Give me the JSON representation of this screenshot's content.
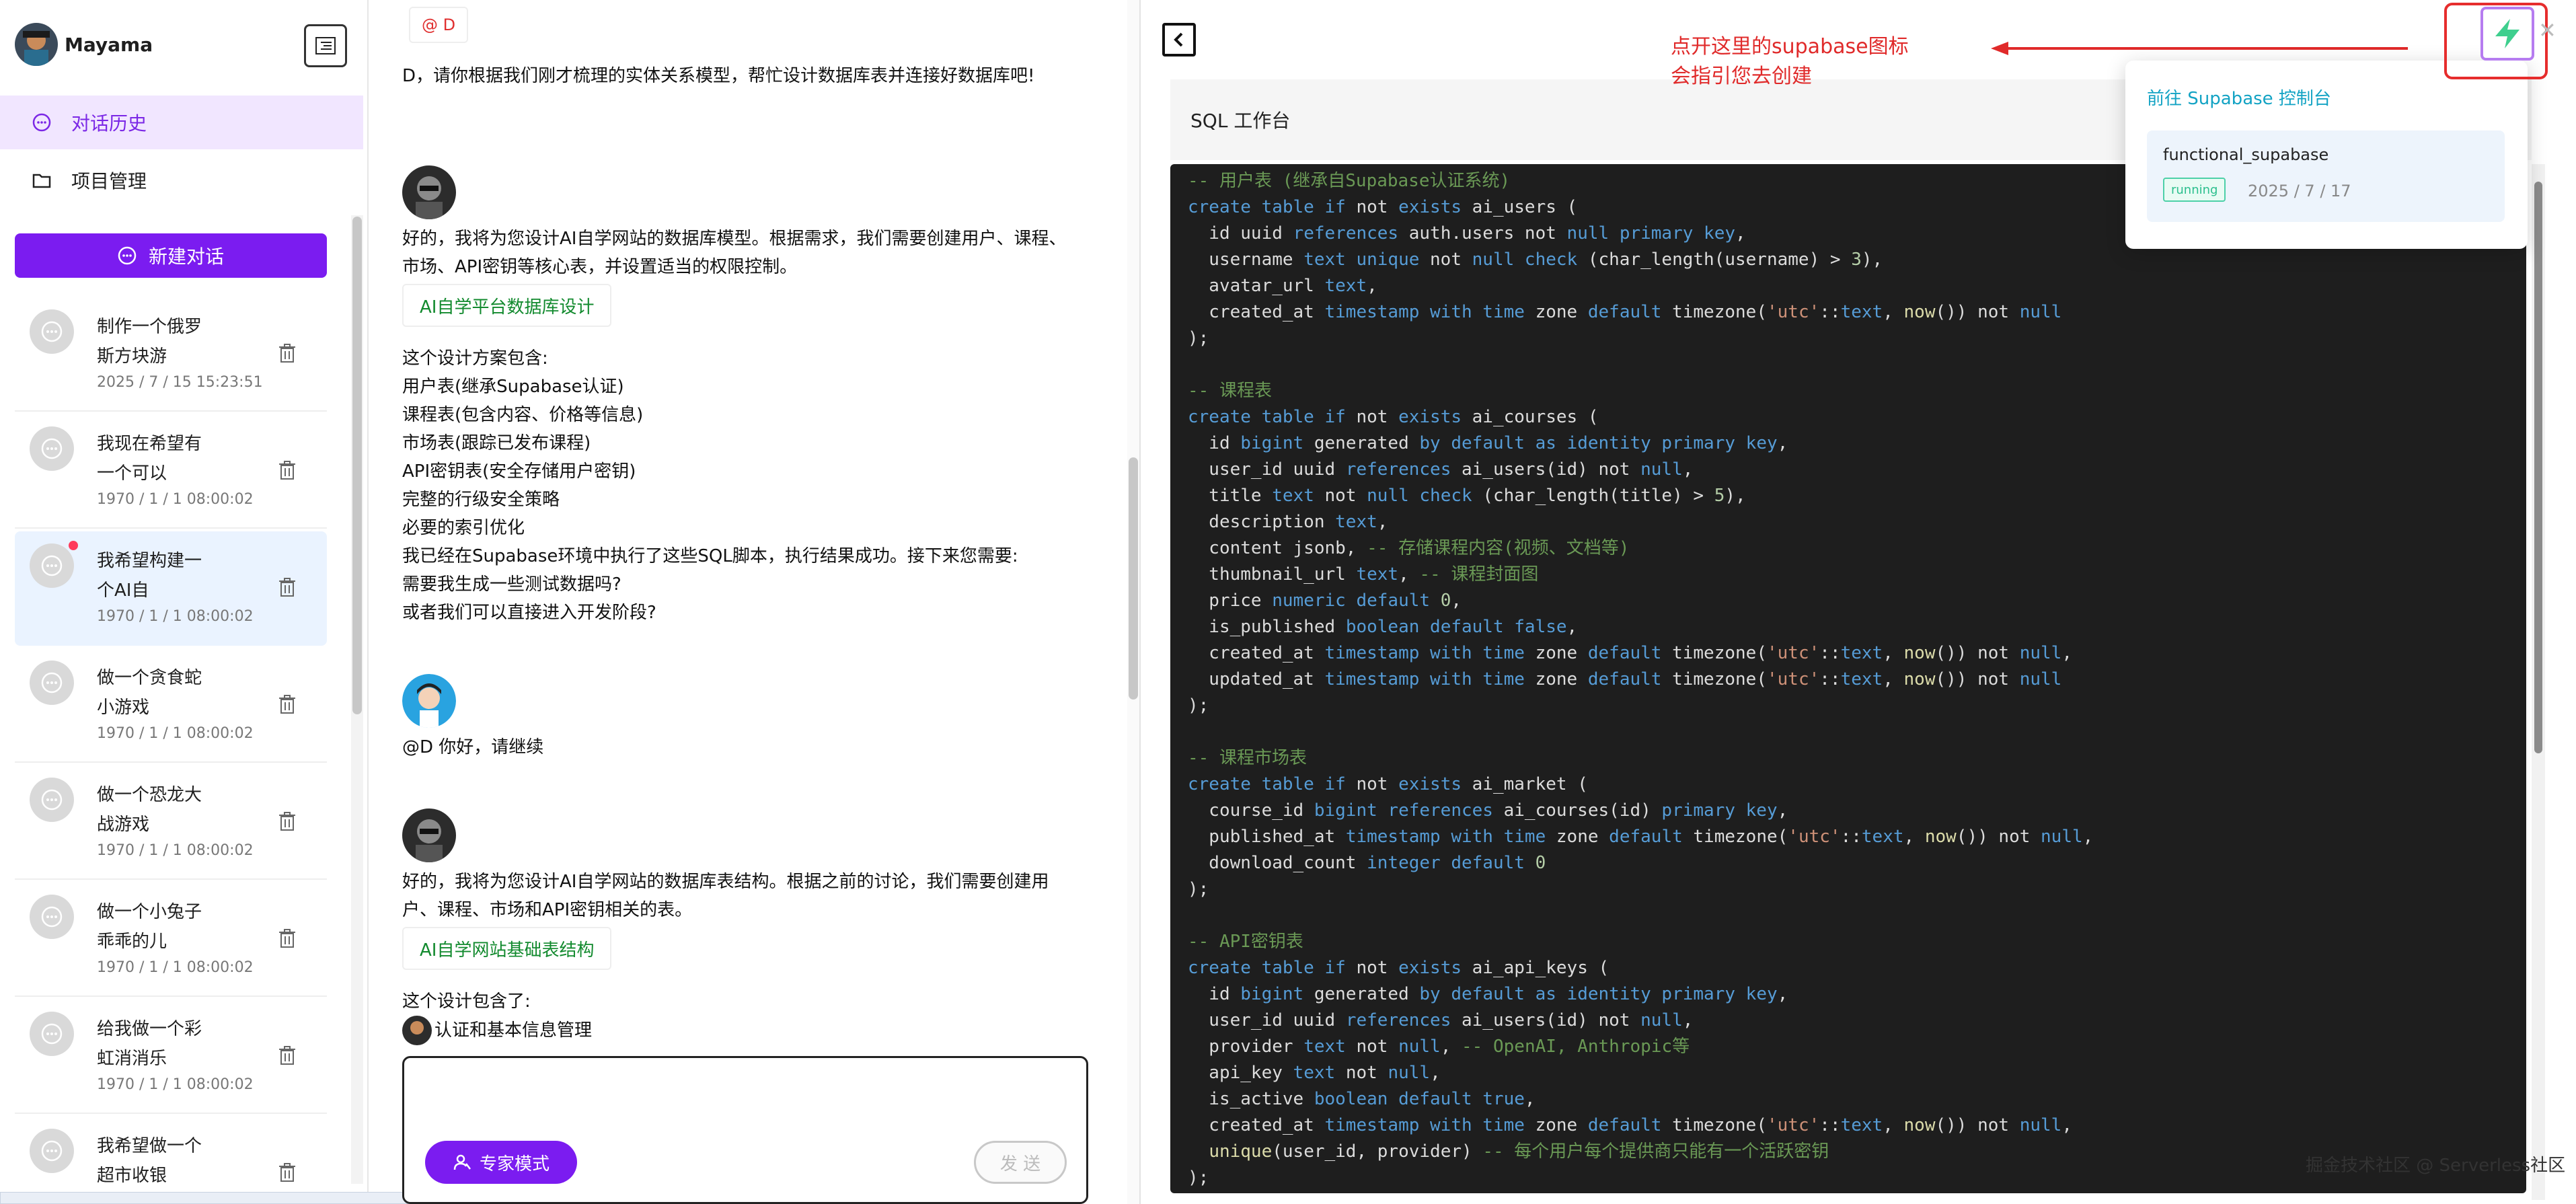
{
  "app": {
    "name": "Mayama"
  },
  "nav": {
    "history": "对话历史",
    "projects": "项目管理"
  },
  "new_chat": "新建对话",
  "conversations": [
    {
      "title": "制作一个俄罗斯方块游",
      "date": "2025 / 7 / 15 15:23:51"
    },
    {
      "title": "我现在希望有一个可以",
      "date": "1970 / 1 / 1 08:00:02"
    },
    {
      "title": "我希望构建一个AI自",
      "date": "1970 / 1 / 1 08:00:02"
    },
    {
      "title": "做一个贪食蛇小游戏",
      "date": "1970 / 1 / 1 08:00:02"
    },
    {
      "title": "做一个恐龙大战游戏",
      "date": "1970 / 1 / 1 08:00:02"
    },
    {
      "title": "做一个小兔子乖乖的儿",
      "date": "1970 / 1 / 1 08:00:02"
    },
    {
      "title": "给我做一个彩虹消消乐",
      "date": "1970 / 1 / 1 08:00:02"
    },
    {
      "title": "我希望做一个超市收银",
      "date": ""
    }
  ],
  "chat": {
    "top_tag": "@ D",
    "prompt": "D，请你根据我们刚才梳理的实体关系模型，帮忙设计数据库表并连接好数据库吧!",
    "reply1_intro": "好的，我将为您设计AI自学网站的数据库模型。根据需求，我们需要创建用户、课程、市场、API密钥等核心表，并设置适当的权限控制。",
    "reply1_link": "AI自学平台数据库设计",
    "reply1_body": [
      "这个设计方案包含:",
      "用户表(继承Supabase认证)",
      "课程表(包含内容、价格等信息)",
      "市场表(跟踪已发布课程)",
      "API密钥表(安全存储用户密钥)",
      "完整的行级安全策略",
      "必要的索引优化",
      "我已经在Supabase环境中执行了这些SQL脚本，执行结果成功。接下来您需要:",
      "需要我生成一些测试数据吗?",
      "或者我们可以直接进入开发阶段?"
    ],
    "user_msg": "@D 你好，请继续",
    "reply2_intro": "好的，我将为您设计AI自学网站的数据库表结构。根据之前的讨论，我们需要创建用户、课程、市场和API密钥相关的表。",
    "reply2_link": "AI自学网站基础表结构",
    "reply2_body": [
      "这个设计包含了:",
      "认证和基本信息管理"
    ],
    "expert_mode": "专家模式",
    "send": "发 送"
  },
  "panel": {
    "title": "SQL 工作台",
    "annotation": [
      "点开这里的supabase图标",
      "会指引您去创建"
    ],
    "popover": {
      "heading": "前往 Supabase 控制台",
      "project": "functional_supabase",
      "status": "running",
      "date": "2025 / 7 / 17"
    },
    "watermark": "掘金技术社区 @ Serverless社区"
  },
  "colors": {
    "brand": "#7b1cf0",
    "annotation": "#e02a2a",
    "supabase": "#3ecf8e"
  },
  "sql_lines": [
    [
      [
        "c",
        "-- 用户表 (继承自Supabase认证系统)"
      ]
    ],
    [
      [
        "k",
        "create table if "
      ],
      [
        "t",
        "not "
      ],
      [
        "k",
        "exists "
      ],
      [
        "t",
        "ai_users ("
      ]
    ],
    [
      [
        "t",
        "  id uuid "
      ],
      [
        "k",
        "references "
      ],
      [
        "t",
        "auth.users not "
      ],
      [
        "k",
        "null primary key"
      ],
      [
        "t",
        ","
      ]
    ],
    [
      [
        "t",
        "  username "
      ],
      [
        "k",
        "text unique "
      ],
      [
        "t",
        "not "
      ],
      [
        "k",
        "null check "
      ],
      [
        "t",
        "(char_length(username) > "
      ],
      [
        "n",
        "3"
      ],
      [
        "t",
        "),"
      ]
    ],
    [
      [
        "t",
        "  avatar_url "
      ],
      [
        "k",
        "text"
      ],
      [
        "t",
        ","
      ]
    ],
    [
      [
        "t",
        "  created_at "
      ],
      [
        "k",
        "timestamp with time "
      ],
      [
        "t",
        "zone "
      ],
      [
        "k",
        "default "
      ],
      [
        "t",
        "timezone("
      ],
      [
        "s",
        "'utc'"
      ],
      [
        "t",
        "::"
      ],
      [
        "k",
        "text"
      ],
      [
        "t",
        ", "
      ],
      [
        "f",
        "now"
      ],
      [
        "t",
        "()) not "
      ],
      [
        "k",
        "null"
      ]
    ],
    [
      [
        "t",
        ");"
      ]
    ],
    [
      [
        "t",
        ""
      ]
    ],
    [
      [
        "c",
        "-- 课程表"
      ]
    ],
    [
      [
        "k",
        "create table if "
      ],
      [
        "t",
        "not "
      ],
      [
        "k",
        "exists "
      ],
      [
        "t",
        "ai_courses ("
      ]
    ],
    [
      [
        "t",
        "  id "
      ],
      [
        "k",
        "bigint "
      ],
      [
        "t",
        "generated "
      ],
      [
        "k",
        "by default as identity primary key"
      ],
      [
        "t",
        ","
      ]
    ],
    [
      [
        "t",
        "  user_id uuid "
      ],
      [
        "k",
        "references "
      ],
      [
        "t",
        "ai_users(id) not "
      ],
      [
        "k",
        "null"
      ],
      [
        "t",
        ","
      ]
    ],
    [
      [
        "t",
        "  title "
      ],
      [
        "k",
        "text "
      ],
      [
        "t",
        "not "
      ],
      [
        "k",
        "null check "
      ],
      [
        "t",
        "(char_length(title) > "
      ],
      [
        "n",
        "5"
      ],
      [
        "t",
        "),"
      ]
    ],
    [
      [
        "t",
        "  description "
      ],
      [
        "k",
        "text"
      ],
      [
        "t",
        ","
      ]
    ],
    [
      [
        "t",
        "  content jsonb, "
      ],
      [
        "c",
        "-- 存储课程内容(视频、文档等)"
      ]
    ],
    [
      [
        "t",
        "  thumbnail_url "
      ],
      [
        "k",
        "text"
      ],
      [
        "t",
        ", "
      ],
      [
        "c",
        "-- 课程封面图"
      ]
    ],
    [
      [
        "t",
        "  price "
      ],
      [
        "k",
        "numeric default "
      ],
      [
        "n",
        "0"
      ],
      [
        "t",
        ","
      ]
    ],
    [
      [
        "t",
        "  is_published "
      ],
      [
        "k",
        "boolean default false"
      ],
      [
        "t",
        ","
      ]
    ],
    [
      [
        "t",
        "  created_at "
      ],
      [
        "k",
        "timestamp with time "
      ],
      [
        "t",
        "zone "
      ],
      [
        "k",
        "default "
      ],
      [
        "t",
        "timezone("
      ],
      [
        "s",
        "'utc'"
      ],
      [
        "t",
        "::"
      ],
      [
        "k",
        "text"
      ],
      [
        "t",
        ", "
      ],
      [
        "f",
        "now"
      ],
      [
        "t",
        "()) not "
      ],
      [
        "k",
        "null"
      ],
      [
        "t",
        ","
      ]
    ],
    [
      [
        "t",
        "  updated_at "
      ],
      [
        "k",
        "timestamp with time "
      ],
      [
        "t",
        "zone "
      ],
      [
        "k",
        "default "
      ],
      [
        "t",
        "timezone("
      ],
      [
        "s",
        "'utc'"
      ],
      [
        "t",
        "::"
      ],
      [
        "k",
        "text"
      ],
      [
        "t",
        ", "
      ],
      [
        "f",
        "now"
      ],
      [
        "t",
        "()) not "
      ],
      [
        "k",
        "null"
      ]
    ],
    [
      [
        "t",
        ");"
      ]
    ],
    [
      [
        "t",
        ""
      ]
    ],
    [
      [
        "c",
        "-- 课程市场表"
      ]
    ],
    [
      [
        "k",
        "create table if "
      ],
      [
        "t",
        "not "
      ],
      [
        "k",
        "exists "
      ],
      [
        "t",
        "ai_market ("
      ]
    ],
    [
      [
        "t",
        "  course_id "
      ],
      [
        "k",
        "bigint references "
      ],
      [
        "t",
        "ai_courses(id) "
      ],
      [
        "k",
        "primary key"
      ],
      [
        "t",
        ","
      ]
    ],
    [
      [
        "t",
        "  published_at "
      ],
      [
        "k",
        "timestamp with time "
      ],
      [
        "t",
        "zone "
      ],
      [
        "k",
        "default "
      ],
      [
        "t",
        "timezone("
      ],
      [
        "s",
        "'utc'"
      ],
      [
        "t",
        "::"
      ],
      [
        "k",
        "text"
      ],
      [
        "t",
        ", "
      ],
      [
        "f",
        "now"
      ],
      [
        "t",
        "()) not "
      ],
      [
        "k",
        "null"
      ],
      [
        "t",
        ","
      ]
    ],
    [
      [
        "t",
        "  download_count "
      ],
      [
        "k",
        "integer default "
      ],
      [
        "n",
        "0"
      ]
    ],
    [
      [
        "t",
        ");"
      ]
    ],
    [
      [
        "t",
        ""
      ]
    ],
    [
      [
        "c",
        "-- API密钥表"
      ]
    ],
    [
      [
        "k",
        "create table if "
      ],
      [
        "t",
        "not "
      ],
      [
        "k",
        "exists "
      ],
      [
        "t",
        "ai_api_keys ("
      ]
    ],
    [
      [
        "t",
        "  id "
      ],
      [
        "k",
        "bigint "
      ],
      [
        "t",
        "generated "
      ],
      [
        "k",
        "by default as identity primary key"
      ],
      [
        "t",
        ","
      ]
    ],
    [
      [
        "t",
        "  user_id uuid "
      ],
      [
        "k",
        "references "
      ],
      [
        "t",
        "ai_users(id) not "
      ],
      [
        "k",
        "null"
      ],
      [
        "t",
        ","
      ]
    ],
    [
      [
        "t",
        "  provider "
      ],
      [
        "k",
        "text "
      ],
      [
        "t",
        "not "
      ],
      [
        "k",
        "null"
      ],
      [
        "t",
        ", "
      ],
      [
        "c",
        "-- OpenAI, Anthropic等"
      ]
    ],
    [
      [
        "t",
        "  api_key "
      ],
      [
        "k",
        "text "
      ],
      [
        "t",
        "not "
      ],
      [
        "k",
        "null"
      ],
      [
        "t",
        ","
      ]
    ],
    [
      [
        "t",
        "  is_active "
      ],
      [
        "k",
        "boolean default true"
      ],
      [
        "t",
        ","
      ]
    ],
    [
      [
        "t",
        "  created_at "
      ],
      [
        "k",
        "timestamp with time "
      ],
      [
        "t",
        "zone "
      ],
      [
        "k",
        "default "
      ],
      [
        "t",
        "timezone("
      ],
      [
        "s",
        "'utc'"
      ],
      [
        "t",
        "::"
      ],
      [
        "k",
        "text"
      ],
      [
        "t",
        ", "
      ],
      [
        "f",
        "now"
      ],
      [
        "t",
        "()) not "
      ],
      [
        "k",
        "null"
      ],
      [
        "t",
        ","
      ]
    ],
    [
      [
        "t",
        "  "
      ],
      [
        "f",
        "unique"
      ],
      [
        "t",
        "(user_id, provider) "
      ],
      [
        "c",
        "-- 每个用户每个提供商只能有一个活跃密钥"
      ]
    ],
    [
      [
        "t",
        ");"
      ]
    ]
  ]
}
